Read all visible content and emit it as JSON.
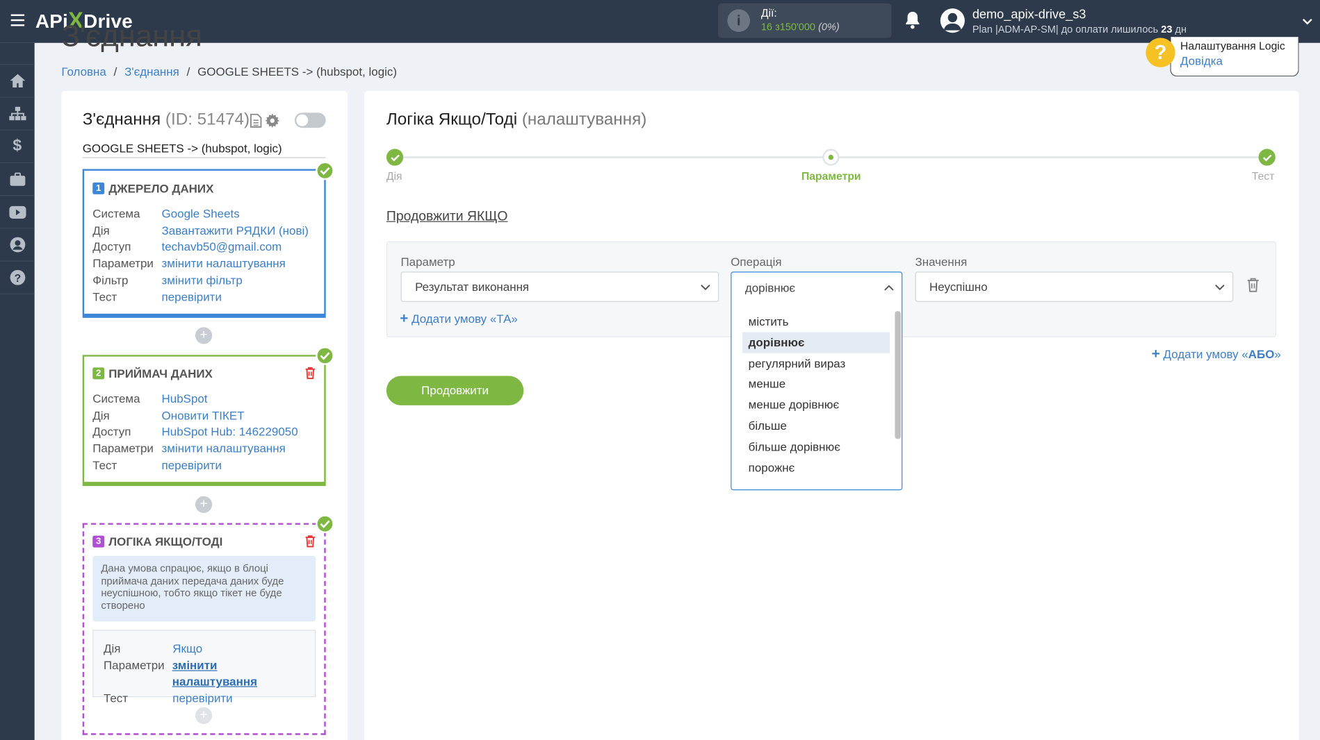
{
  "topbar": {
    "logo": {
      "api": "APi",
      "x": "X",
      "drive": "Drive"
    },
    "actions_label": "Дії:",
    "actions_used": "16",
    "actions_of": "з",
    "actions_total": "150'000",
    "actions_percent": "(0%)",
    "username": "demo_apix-drive_s3",
    "plan_prefix": "Plan |ADM-AP-SM| до оплати лишилось",
    "days_left": "23",
    "days_unit": "дн"
  },
  "page": {
    "title": "З'єднання",
    "breadcrumb": {
      "home": "Головна",
      "connections": "З'єднання",
      "current": "GOOGLE SHEETS -> (hubspot, logic)"
    }
  },
  "help": {
    "title": "Налаштування Logic",
    "link": "Довідка"
  },
  "left_panel": {
    "title": "З'єднання",
    "id_text": "(ID: 51474)",
    "connection_name": "GOOGLE SHEETS -> (hubspot, logic)",
    "source": {
      "num": "1",
      "title": "ДЖЕРЕЛО ДАНИХ",
      "rows": [
        {
          "k": "Система",
          "v": "Google Sheets"
        },
        {
          "k": "Дія",
          "v": "Завантажити РЯДКИ (нові)"
        },
        {
          "k": "Доступ",
          "v": "techavb50@gmail.com"
        },
        {
          "k": "Параметри",
          "v": "змінити налаштування"
        },
        {
          "k": "Фільтр",
          "v": "змінити фільтр"
        },
        {
          "k": "Тест",
          "v": "перевірити"
        }
      ]
    },
    "receiver": {
      "num": "2",
      "title": "ПРИЙМАЧ ДАНИХ",
      "rows": [
        {
          "k": "Система",
          "v": "HubSpot"
        },
        {
          "k": "Дія",
          "v": "Оновити ТІКЕТ"
        },
        {
          "k": "Доступ",
          "v": "HubSpot Hub: 146229050"
        },
        {
          "k": "Параметри",
          "v": "змінити налаштування"
        },
        {
          "k": "Тест",
          "v": "перевірити"
        }
      ]
    },
    "logic": {
      "num": "3",
      "title": "ЛОГІКА ЯКЩО/ТОДІ",
      "note": "Дана умова спрацює, якщо в блоці приймача даних передача даних буде неуспішною, тобто якщо тікет не буде створено",
      "rows": [
        {
          "k": "Дія",
          "v": "Якщо"
        },
        {
          "k": "Параметри",
          "v": "змінити налаштування"
        },
        {
          "k": "Тест",
          "v": "перевірити"
        }
      ]
    }
  },
  "main": {
    "title": "Логіка Якщо/Тоді",
    "subtitle": "(налаштування)",
    "steps": [
      {
        "label": "Дія",
        "state": "done"
      },
      {
        "label": "Параметри",
        "state": "current"
      },
      {
        "label": "Тест",
        "state": "done"
      }
    ],
    "section_title": "Продовжити ЯКЩО",
    "condition": {
      "param_label": "Параметр",
      "param_value": "Результат виконання",
      "op_label": "Операція",
      "op_value": "дорівнює",
      "value_label": "Значення",
      "value_value": "Неуспішно"
    },
    "add_and": "Додати умову «ТА»",
    "add_or_prefix": "Додати умову «",
    "add_or_word": "АБО",
    "add_or_suffix": "»",
    "continue_button": "Продовжити",
    "dropdown_options": [
      "містить",
      "дорівнює",
      "регулярний вираз",
      "менше",
      "менше дорівнює",
      "більше",
      "більше дорівнює",
      "порожнє"
    ],
    "dropdown_selected": "дорівнює"
  },
  "colors": {
    "topbar": "#2d3a4b",
    "accent_green": "#7eb843",
    "link_blue": "#3d7fc6",
    "source_blue": "#3d86d8",
    "logic_purple": "#b04fd2",
    "danger": "#e53935"
  }
}
